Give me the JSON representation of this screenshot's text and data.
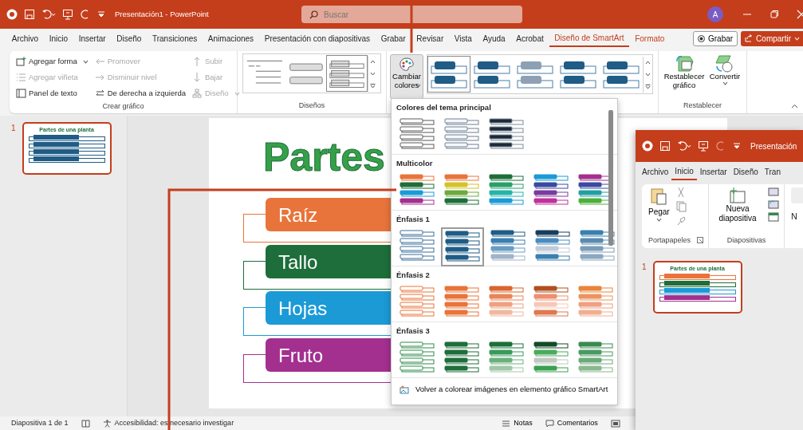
{
  "window": {
    "title": "Presentación1 - PowerPoint",
    "search_placeholder": "Buscar",
    "account_initial": "A"
  },
  "tabs": [
    {
      "label": "Archivo",
      "selected": false,
      "contextual": false
    },
    {
      "label": "Inicio",
      "selected": false,
      "contextual": false
    },
    {
      "label": "Insertar",
      "selected": false,
      "contextual": false
    },
    {
      "label": "Diseño",
      "selected": false,
      "contextual": false
    },
    {
      "label": "Transiciones",
      "selected": false,
      "contextual": false
    },
    {
      "label": "Animaciones",
      "selected": false,
      "contextual": false
    },
    {
      "label": "Presentación con diapositivas",
      "selected": false,
      "contextual": false
    },
    {
      "label": "Grabar",
      "selected": false,
      "contextual": false
    },
    {
      "label": "Revisar",
      "selected": false,
      "contextual": false
    },
    {
      "label": "Vista",
      "selected": false,
      "contextual": false
    },
    {
      "label": "Ayuda",
      "selected": false,
      "contextual": false
    },
    {
      "label": "Acrobat",
      "selected": false,
      "contextual": false
    },
    {
      "label": "Diseño de SmartArt",
      "selected": true,
      "contextual": true
    },
    {
      "label": "Formato",
      "selected": false,
      "contextual": true
    }
  ],
  "tab_actions": [
    {
      "label": "Grabar",
      "kind": "record"
    },
    {
      "label": "Compartir",
      "kind": "share"
    }
  ],
  "ribbon": {
    "create_group": {
      "label": "Crear gráfico",
      "columns": [
        [
          {
            "label": "Agregar forma",
            "disabled": false,
            "dropdown": true
          },
          {
            "label": "Agregar viñeta",
            "disabled": true,
            "dropdown": false
          },
          {
            "label": "Panel de texto",
            "disabled": false,
            "dropdown": false
          }
        ],
        [
          {
            "label": "Promover",
            "disabled": true,
            "dropdown": false
          },
          {
            "label": "Disminuir nivel",
            "disabled": true,
            "dropdown": false
          },
          {
            "label": "De derecha a izquierda",
            "disabled": false,
            "dropdown": false
          }
        ],
        [
          {
            "label": "Subir",
            "disabled": true,
            "dropdown": false
          },
          {
            "label": "Bajar",
            "disabled": true,
            "dropdown": false
          },
          {
            "label": "Diseño",
            "disabled": true,
            "dropdown": true
          }
        ]
      ]
    },
    "layouts_group": {
      "label": "Diseños",
      "layouts": [
        {
          "selected": false
        },
        {
          "selected": false
        },
        {
          "selected": true
        }
      ]
    },
    "change_colors": {
      "label": "Cambiar colores",
      "pressed": true
    },
    "styles": [
      {
        "color": "#1f5c86",
        "selected": true
      },
      {
        "color": "#1f5c86",
        "selected": false
      },
      {
        "color": "#8da0b4",
        "selected": false
      },
      {
        "color": "#1f5c86",
        "selected": false
      },
      {
        "color": "#1f5c86",
        "selected": false
      }
    ],
    "reset_group": {
      "label": "Restablecer",
      "buttons": [
        {
          "label": "Restablecer gráfico",
          "dropdown": false
        },
        {
          "label": "Convertir",
          "dropdown": true
        }
      ]
    }
  },
  "thumbnails": [
    {
      "number": "1",
      "title": "Partes de una planta",
      "selected": true
    }
  ],
  "slide": {
    "title": "Partes",
    "items": [
      {
        "text": "Raíz",
        "color": "#e8743b"
      },
      {
        "text": "Tallo",
        "color": "#1e6e3b"
      },
      {
        "text": "Hojas",
        "color": "#1b9ad6"
      },
      {
        "text": "Fruto",
        "color": "#a3308f"
      }
    ]
  },
  "color_menu": {
    "sections": [
      {
        "title": "Colores del tema principal",
        "options": [
          {
            "selected": false
          },
          {
            "selected": false
          },
          {
            "selected": false
          }
        ]
      },
      {
        "title": "Multicolor",
        "options": [
          {
            "selected": false
          },
          {
            "selected": false
          },
          {
            "selected": false
          },
          {
            "selected": false
          },
          {
            "selected": false
          }
        ]
      },
      {
        "title": "Énfasis 1",
        "options": [
          {
            "selected": false
          },
          {
            "selected": true
          },
          {
            "selected": false
          },
          {
            "selected": false
          },
          {
            "selected": false
          }
        ]
      },
      {
        "title": "Énfasis 2",
        "options": [
          {
            "selected": false
          },
          {
            "selected": false
          },
          {
            "selected": false
          },
          {
            "selected": false
          },
          {
            "selected": false
          }
        ]
      },
      {
        "title": "Énfasis 3",
        "options": [
          {
            "selected": false
          },
          {
            "selected": false
          },
          {
            "selected": false
          },
          {
            "selected": false
          },
          {
            "selected": false
          }
        ]
      }
    ],
    "footer": "Volver a colorear imágenes en elemento gráfico SmartArt"
  },
  "status_bar": {
    "slide_info": "Diapositiva 1 de 1",
    "accessibility": "Accesibilidad: es necesario investigar",
    "notes": "Notas",
    "comments": "Comentarios"
  },
  "second_window": {
    "title": "Presentación",
    "tabs": [
      {
        "label": "Archivo",
        "selected": false
      },
      {
        "label": "Inicio",
        "selected": true
      },
      {
        "label": "Insertar",
        "selected": false
      },
      {
        "label": "Diseño",
        "selected": false
      },
      {
        "label": "Tran",
        "selected": false
      }
    ],
    "paste": "Pegar",
    "new_slide": "Nueva diapositiva",
    "cut_letter": "N",
    "groups": [
      "Portapapeles",
      "Diapositivas"
    ],
    "thumbnails": [
      {
        "number": "1",
        "title": "Partes de una planta",
        "selected": true
      }
    ]
  }
}
